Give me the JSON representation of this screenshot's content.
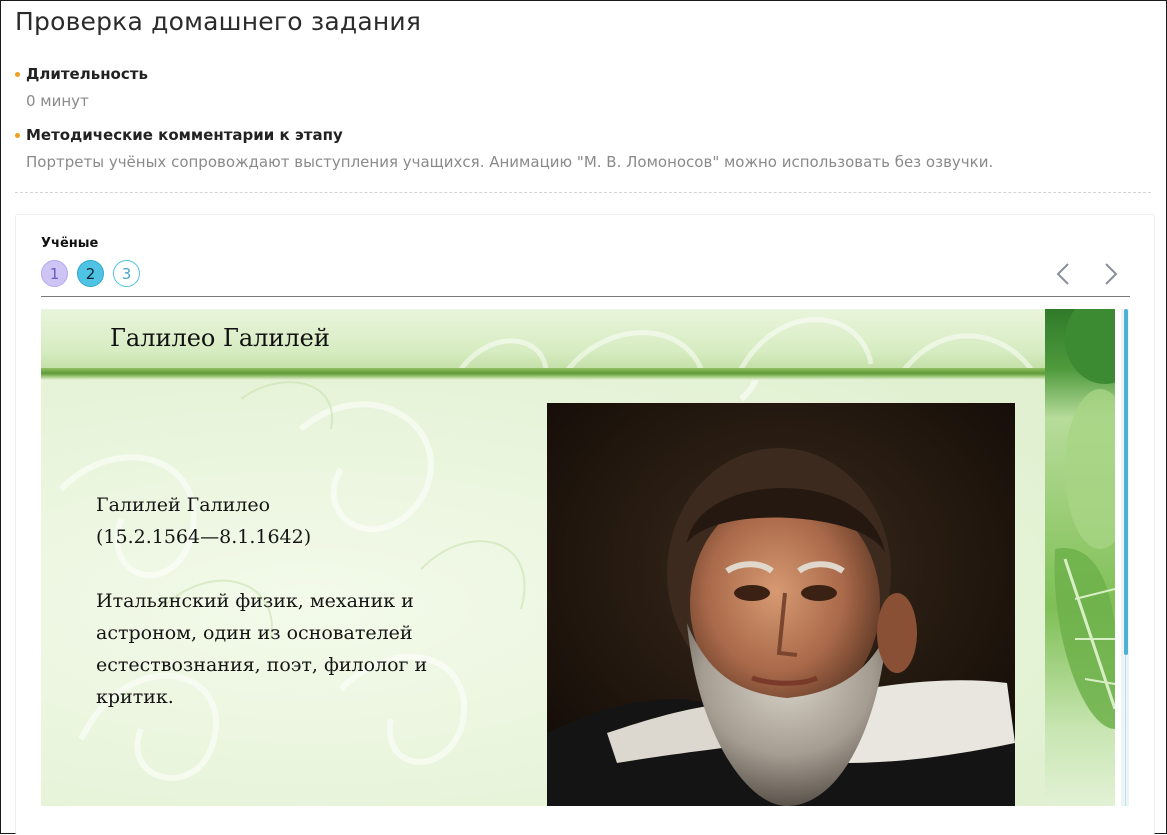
{
  "page": {
    "title": "Проверка домашнего задания"
  },
  "meta": [
    {
      "label": "Длительность",
      "value": "0 минут"
    },
    {
      "label": "Методические комментарии к этапу",
      "value": "Портреты учёных сопровождают выступления учащихся. Анимацию \"М. В. Ломоносов\" можно использовать без озвучки."
    }
  ],
  "colors": {
    "bullet": "#f0a020",
    "accent": "#4fc3e4",
    "visited": "#cfc5f5"
  },
  "viewer": {
    "section_title": "Учёные",
    "pages": [
      {
        "label": "1",
        "state": "visited"
      },
      {
        "label": "2",
        "state": "active"
      },
      {
        "label": "3",
        "state": "default"
      }
    ],
    "prev_icon": "chevron-left-icon",
    "next_icon": "chevron-right-icon"
  },
  "slide": {
    "title": "Галилео Галилей",
    "name": "Галилей Галилео",
    "dates": "(15.2.1564—8.1.1642)",
    "description_lines": [
      "Итальянский физик, механик и",
      "астроном, один из основателей",
      "естествознания, поэт, филолог и",
      "критик."
    ],
    "portrait_icon": "portrait-image"
  }
}
